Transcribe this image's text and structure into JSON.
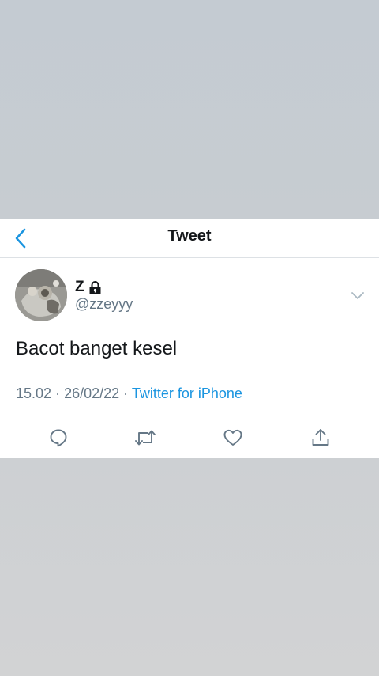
{
  "header": {
    "title": "Tweet",
    "back_icon": "chevron-left-icon"
  },
  "author": {
    "display_name": "Z",
    "lock_icon": "lock-icon",
    "handle": "@zzeyyy"
  },
  "tweet": {
    "text": "Bacot banget kesel",
    "time": "15.02",
    "separator1": "·",
    "date": "26/02/22",
    "separator2": "·",
    "source": "Twitter for iPhone"
  },
  "actions": [
    "reply-icon",
    "retweet-icon",
    "like-icon",
    "share-icon"
  ],
  "colors": {
    "accent": "#1b95e0",
    "text": "#14171a",
    "secondary_text": "#657786",
    "background_top": "#c4cbd2",
    "background_bottom": "#d0d2d4"
  }
}
